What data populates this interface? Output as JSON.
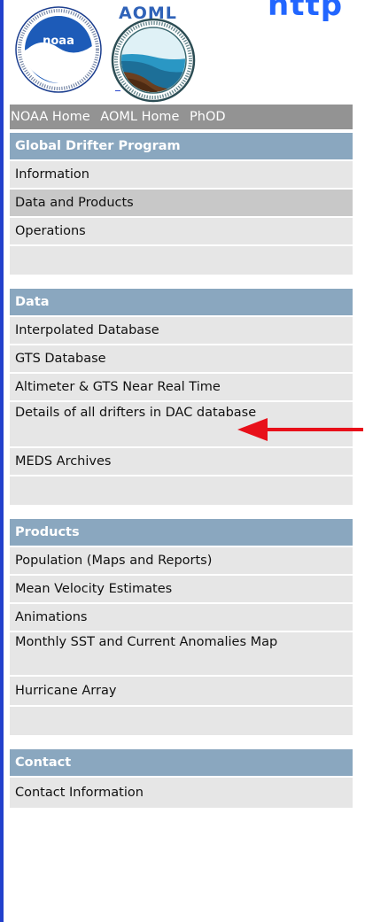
{
  "header": {
    "url_fragment": "http"
  },
  "logos": {
    "noaa_text": "noaa",
    "aoml_text": "AOML"
  },
  "topnav": {
    "items": [
      "NOAA Home",
      "AOML Home",
      "PhOD"
    ]
  },
  "menu": {
    "program_heading": "Global Drifter Program",
    "program_items": [
      "Information",
      "Data and Products",
      "Operations"
    ],
    "data_heading": "Data",
    "data_items": [
      "Interpolated Database",
      "GTS Database",
      "Altimeter & GTS Near Real Time",
      "Details of all drifters in DAC database",
      "MEDS Archives"
    ],
    "products_heading": "Products",
    "products_items": [
      "Population (Maps and Reports)",
      "Mean Velocity Estimates",
      "Animations",
      "Monthly SST and Current Anomalies Map",
      "Hurricane Array"
    ],
    "contact_heading": "Contact",
    "contact_items": [
      "Contact Information"
    ]
  },
  "colors": {
    "heading_bg": "#8aa7bf",
    "item_bg": "#e6e6e6",
    "active_bg": "#c8c8c8",
    "topnav_bg": "#939393",
    "arrow": "#e8101a",
    "accent_blue": "#2240cc"
  }
}
